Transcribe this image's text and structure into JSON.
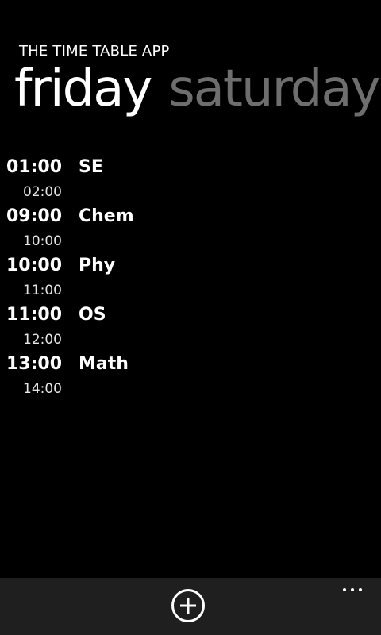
{
  "app": {
    "title": "THE TIME TABLE APP"
  },
  "pivot": {
    "items": [
      {
        "label": "friday",
        "active": true
      },
      {
        "label": "saturday",
        "active": false
      }
    ]
  },
  "schedule": [
    {
      "start": "01:00",
      "end": "02:00",
      "subject": "SE"
    },
    {
      "start": "09:00",
      "end": "10:00",
      "subject": "Chem"
    },
    {
      "start": "10:00",
      "end": "11:00",
      "subject": "Phy"
    },
    {
      "start": "11:00",
      "end": "12:00",
      "subject": "OS"
    },
    {
      "start": "13:00",
      "end": "14:00",
      "subject": "Math"
    }
  ],
  "app_bar": {
    "add_icon": "add-circle-icon",
    "more_icon": "ellipsis-icon"
  },
  "colors": {
    "background": "#000000",
    "inactive_pivot": "#6e6e6e",
    "app_bar": "#1f1f1f"
  }
}
